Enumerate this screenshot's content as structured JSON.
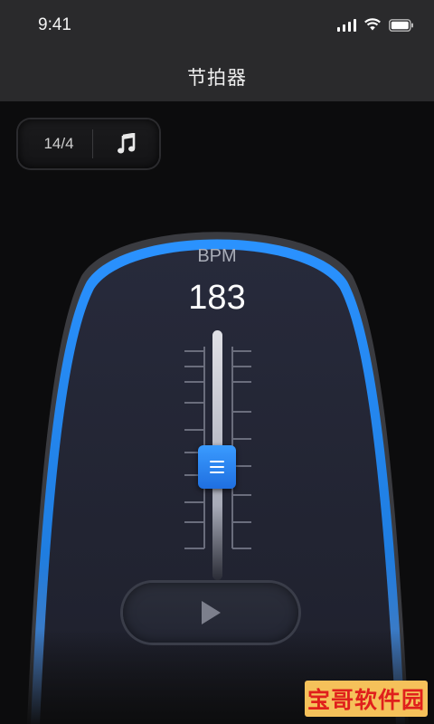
{
  "status_bar": {
    "time": "9:41"
  },
  "header": {
    "title": "节拍器"
  },
  "beat_selector": {
    "value": "14/4",
    "icon": "music-note-icon"
  },
  "metronome": {
    "bpm_label": "BPM",
    "bpm_value": "183"
  },
  "controls": {
    "play_icon": "play-icon"
  },
  "watermark": {
    "text": "宝哥软件园"
  },
  "colors": {
    "accent": "#2e8dff",
    "panel": "#252838",
    "header": "#2a2a2c"
  }
}
